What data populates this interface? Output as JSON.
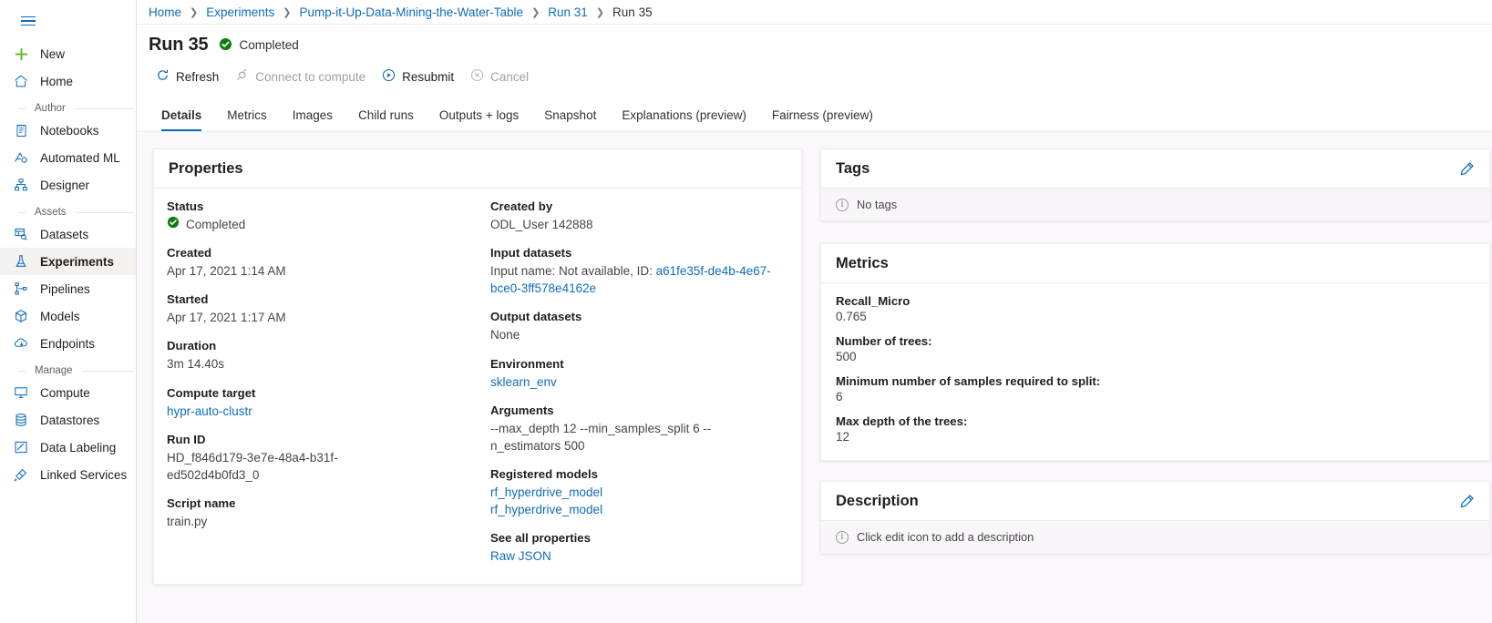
{
  "sidebar": {
    "menu_icon": "hamburger-icon",
    "top_items": [
      {
        "label": "New",
        "icon": "plus-icon"
      },
      {
        "label": "Home",
        "icon": "home-icon"
      }
    ],
    "groups": [
      {
        "title": "Author",
        "items": [
          {
            "label": "Notebooks",
            "icon": "notebook-icon"
          },
          {
            "label": "Automated ML",
            "icon": "automated-ml-icon"
          },
          {
            "label": "Designer",
            "icon": "designer-icon"
          }
        ]
      },
      {
        "title": "Assets",
        "items": [
          {
            "label": "Datasets",
            "icon": "datasets-icon"
          },
          {
            "label": "Experiments",
            "icon": "flask-icon"
          },
          {
            "label": "Pipelines",
            "icon": "pipelines-icon"
          },
          {
            "label": "Models",
            "icon": "cube-icon"
          },
          {
            "label": "Endpoints",
            "icon": "endpoints-icon"
          }
        ]
      },
      {
        "title": "Manage",
        "items": [
          {
            "label": "Compute",
            "icon": "compute-icon"
          },
          {
            "label": "Datastores",
            "icon": "database-icon"
          },
          {
            "label": "Data Labeling",
            "icon": "data-labeling-icon"
          },
          {
            "label": "Linked Services",
            "icon": "linked-services-icon"
          }
        ]
      }
    ],
    "selected": "Experiments"
  },
  "breadcrumb": [
    {
      "label": "Home",
      "current": false
    },
    {
      "label": "Experiments",
      "current": false
    },
    {
      "label": "Pump-it-Up-Data-Mining-the-Water-Table",
      "current": false
    },
    {
      "label": "Run 31",
      "current": false
    },
    {
      "label": "Run 35",
      "current": true
    }
  ],
  "header": {
    "title": "Run 35",
    "status": "Completed",
    "status_icon": "check-circle-icon"
  },
  "toolbar": [
    {
      "label": "Refresh",
      "icon": "refresh-icon",
      "disabled": false
    },
    {
      "label": "Connect to compute",
      "icon": "plug-icon",
      "disabled": true
    },
    {
      "label": "Resubmit",
      "icon": "play-circle-icon",
      "disabled": false
    },
    {
      "label": "Cancel",
      "icon": "cancel-circle-icon",
      "disabled": true
    }
  ],
  "tabs": [
    {
      "label": "Details",
      "active": true
    },
    {
      "label": "Metrics",
      "active": false
    },
    {
      "label": "Images",
      "active": false
    },
    {
      "label": "Child runs",
      "active": false
    },
    {
      "label": "Outputs + logs",
      "active": false
    },
    {
      "label": "Snapshot",
      "active": false
    },
    {
      "label": "Explanations (preview)",
      "active": false
    },
    {
      "label": "Fairness (preview)",
      "active": false
    }
  ],
  "properties": {
    "title": "Properties",
    "left": {
      "status_label": "Status",
      "status_value": "Completed",
      "created_label": "Created",
      "created_value": "Apr 17, 2021 1:14 AM",
      "started_label": "Started",
      "started_value": "Apr 17, 2021 1:17 AM",
      "duration_label": "Duration",
      "duration_value": "3m 14.40s",
      "compute_label": "Compute target",
      "compute_value": "hypr-auto-clustr",
      "runid_label": "Run ID",
      "runid_value": "HD_f846d179-3e7e-48a4-b31f-ed502d4b0fd3_0",
      "script_label": "Script name",
      "script_value": "train.py"
    },
    "right": {
      "created_by_label": "Created by",
      "created_by_value": "ODL_User 142888",
      "input_datasets_label": "Input datasets",
      "input_datasets_prefix": "Input name: Not available, ID:",
      "input_datasets_id": "a61fe35f-de4b-4e67-bce0-3ff578e4162e",
      "output_datasets_label": "Output datasets",
      "output_datasets_value": "None",
      "environment_label": "Environment",
      "environment_value": "sklearn_env",
      "arguments_label": "Arguments",
      "arguments_value": "--max_depth 12 --min_samples_split 6 --n_estimators 500",
      "registered_models_label": "Registered models",
      "registered_models": [
        "rf_hyperdrive_model",
        "rf_hyperdrive_model"
      ],
      "see_all_label": "See all properties",
      "raw_json_label": "Raw JSON"
    }
  },
  "tags": {
    "title": "Tags",
    "empty_message": "No tags",
    "edit_icon": "pencil-icon"
  },
  "metrics": {
    "title": "Metrics",
    "items": [
      {
        "name": "Recall_Micro",
        "value": "0.765"
      },
      {
        "name": "Number of trees:",
        "value": "500"
      },
      {
        "name": "Minimum number of samples required to split:",
        "value": "6"
      },
      {
        "name": "Max depth of the trees:",
        "value": "12"
      }
    ]
  },
  "description": {
    "title": "Description",
    "empty_message": "Click edit icon to add a description",
    "edit_icon": "pencil-icon"
  },
  "colors": {
    "accent": "#0f6cbd",
    "success": "#107c10",
    "disabled": "#a19f9d",
    "page_bg": "#faf8fa",
    "empty_bar_bg": "#faf5fa"
  }
}
